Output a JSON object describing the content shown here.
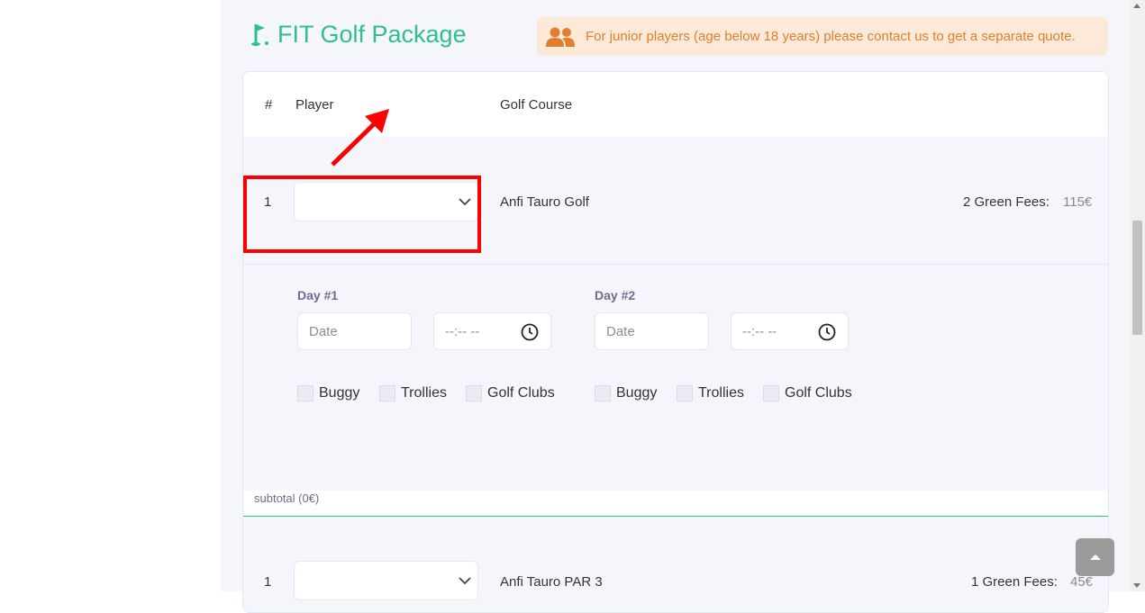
{
  "page": {
    "title": "FIT Golf Package",
    "notice": "For junior players (age below 18 years) please contact us to get a separate quote."
  },
  "colors": {
    "accent_green": "#2fbf8a",
    "notice_orange": "#e07f2e",
    "notice_bg": "#fde9d8",
    "highlight_red": "#ff0000"
  },
  "icons": [
    "golf-flag-icon",
    "users-icon",
    "chevron-down-icon",
    "clock-icon",
    "arrow-icon",
    "caret-up-icon"
  ],
  "table": {
    "headers": {
      "num": "#",
      "player": "Player",
      "course": "Golf Course"
    }
  },
  "rows": [
    {
      "num": "1",
      "player_value": "",
      "course": "Anfi Tauro Golf",
      "fees_label": "2 Green Fees:",
      "fees_price": "115€",
      "days": [
        {
          "label": "Day #1",
          "date_placeholder": "Date",
          "time_placeholder": "--:-- --",
          "options": [
            "Buggy",
            "Trollies",
            "Golf Clubs"
          ]
        },
        {
          "label": "Day #2",
          "date_placeholder": "Date",
          "time_placeholder": "--:-- --",
          "options": [
            "Buggy",
            "Trollies",
            "Golf Clubs"
          ]
        }
      ],
      "subtotal": "subtotal (0€)"
    },
    {
      "num": "1",
      "player_value": "",
      "course": "Anfi Tauro PAR 3",
      "fees_label": "1 Green Fees:",
      "fees_price": "45€"
    }
  ]
}
